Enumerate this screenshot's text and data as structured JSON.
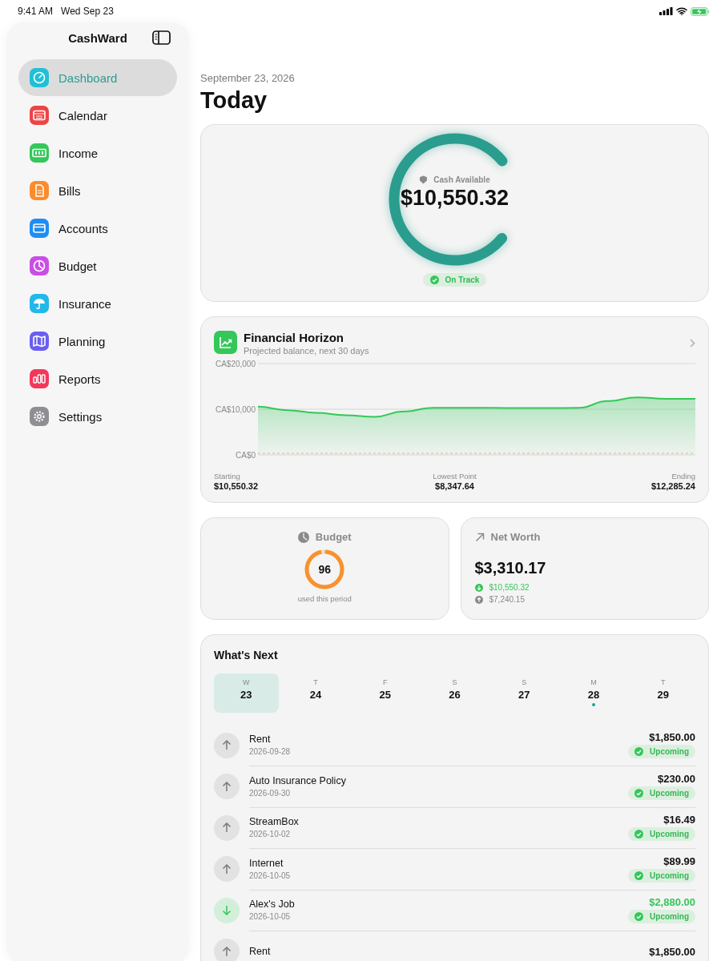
{
  "status_bar": {
    "time": "9:41 AM",
    "date": "Wed Sep 23"
  },
  "sidebar": {
    "title": "CashWard",
    "items": [
      {
        "label": "Dashboard",
        "selected": true,
        "color": "#1fc1d6"
      },
      {
        "label": "Calendar",
        "selected": false,
        "color": "#ef4444"
      },
      {
        "label": "Income",
        "selected": false,
        "color": "#34c759"
      },
      {
        "label": "Bills",
        "selected": false,
        "color": "#fb8c2c"
      },
      {
        "label": "Accounts",
        "selected": false,
        "color": "#1e8ef5"
      },
      {
        "label": "Budget",
        "selected": false,
        "color": "#c94ee6"
      },
      {
        "label": "Insurance",
        "selected": false,
        "color": "#22b8e8"
      },
      {
        "label": "Planning",
        "selected": false,
        "color": "#6a5ef2"
      },
      {
        "label": "Reports",
        "selected": false,
        "color": "#f2385a"
      },
      {
        "label": "Settings",
        "selected": false,
        "color": "#8e8e93"
      }
    ]
  },
  "header": {
    "date": "September 23, 2026",
    "title": "Today"
  },
  "cash": {
    "label": "Cash Available",
    "amount": "$10,550.32",
    "level": 0.78,
    "status": "On Track"
  },
  "horizon": {
    "title": "Financial Horizon",
    "subtitle": "Projected balance, next 30 days",
    "axis_labels": [
      "CA$20,000",
      "CA$10,000",
      "CA$0"
    ],
    "stats": [
      {
        "label": "Starting",
        "value": "$10,550.32"
      },
      {
        "label": "Lowest Point",
        "value": "$8,347.64"
      },
      {
        "label": "Ending",
        "value": "$12,285.24"
      }
    ]
  },
  "budget": {
    "title": "Budget",
    "value": "96",
    "level": 0.96,
    "caption": "used this period"
  },
  "net_worth": {
    "title": "Net Worth",
    "amount": "$3,310.17",
    "lines": [
      {
        "kind": "in",
        "value": "$10,550.32"
      },
      {
        "kind": "out",
        "value": "$7,240.15"
      }
    ]
  },
  "whats_next": {
    "title": "What's Next",
    "days": [
      {
        "weekday": "W",
        "day": "23",
        "selected": true,
        "has_event": false
      },
      {
        "weekday": "T",
        "day": "24",
        "selected": false,
        "has_event": false
      },
      {
        "weekday": "F",
        "day": "25",
        "selected": false,
        "has_event": false
      },
      {
        "weekday": "S",
        "day": "26",
        "selected": false,
        "has_event": false
      },
      {
        "weekday": "S",
        "day": "27",
        "selected": false,
        "has_event": false
      },
      {
        "weekday": "M",
        "day": "28",
        "selected": false,
        "has_event": true
      },
      {
        "weekday": "T",
        "day": "29",
        "selected": false,
        "has_event": false
      }
    ],
    "items": [
      {
        "kind": "expense",
        "name": "Rent",
        "date": "2026-09-28",
        "amount": "$1,850.00",
        "status": "Upcoming"
      },
      {
        "kind": "expense",
        "name": "Auto Insurance Policy",
        "date": "2026-09-30",
        "amount": "$230.00",
        "status": "Upcoming"
      },
      {
        "kind": "expense",
        "name": "StreamBox",
        "date": "2026-10-02",
        "amount": "$16.49",
        "status": "Upcoming"
      },
      {
        "kind": "expense",
        "name": "Internet",
        "date": "2026-10-05",
        "amount": "$89.99",
        "status": "Upcoming"
      },
      {
        "kind": "income",
        "name": "Alex's Job",
        "date": "2026-10-05",
        "amount": "$2,880.00",
        "status": "Upcoming"
      },
      {
        "kind": "expense",
        "name": "Rent",
        "amount": "$1,850.00"
      }
    ]
  }
}
